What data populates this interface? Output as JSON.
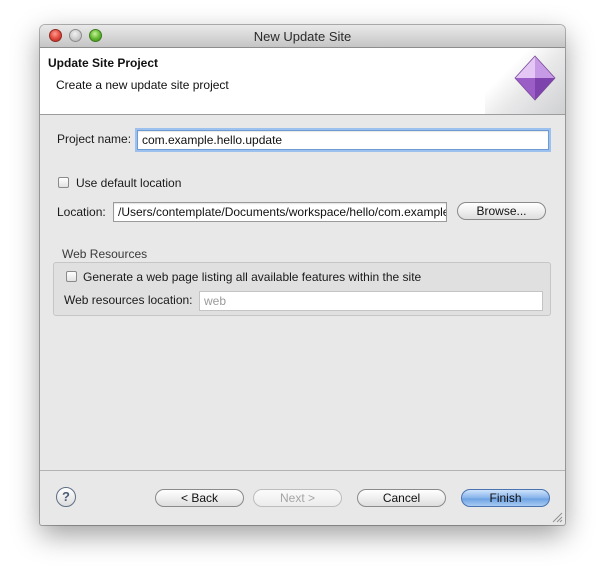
{
  "window": {
    "title": "New Update Site"
  },
  "header": {
    "title": "Update Site Project",
    "description": "Create a new update site project"
  },
  "form": {
    "project_name_label": "Project name:",
    "project_name_value": "com.example.hello.update",
    "use_default_location_label": "Use default location",
    "use_default_location_checked": false,
    "location_label": "Location:",
    "location_value": "/Users/contemplate/Documents/workspace/hello/com.example.hello.update",
    "browse_label": "Browse..."
  },
  "web_resources": {
    "group_label": "Web Resources",
    "generate_label": "Generate a web page listing all available features within the site",
    "generate_checked": false,
    "location_label": "Web resources location:",
    "location_value": "web"
  },
  "buttons": {
    "help_label": "?",
    "back_label": "< Back",
    "next_label": "Next >",
    "cancel_label": "Cancel",
    "finish_label": "Finish"
  },
  "icons": [
    "close-window-icon",
    "minimize-window-icon",
    "zoom-window-icon",
    "wizard-banner-icon",
    "help-icon",
    "resize-grip-icon"
  ]
}
